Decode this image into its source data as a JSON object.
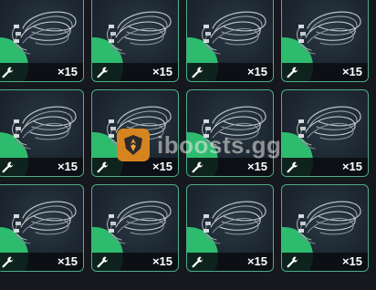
{
  "inventory": {
    "item_name_icon": "wire-harness-icon",
    "craft_icon": "wrench-icon",
    "accent_color": "#2dbb6e",
    "border_color": "#4fae8a",
    "slots": [
      {
        "quantity": "×15"
      },
      {
        "quantity": "×15"
      },
      {
        "quantity": "×15"
      },
      {
        "quantity": "×15"
      },
      {
        "quantity": "×15"
      },
      {
        "quantity": "×15"
      },
      {
        "quantity": "×15"
      },
      {
        "quantity": "×15"
      },
      {
        "quantity": "×15"
      },
      {
        "quantity": "×15"
      },
      {
        "quantity": "×15"
      },
      {
        "quantity": "×15"
      }
    ]
  },
  "watermark": {
    "text": "iboosts.gg",
    "logo_icon": "shield-logo-icon"
  }
}
